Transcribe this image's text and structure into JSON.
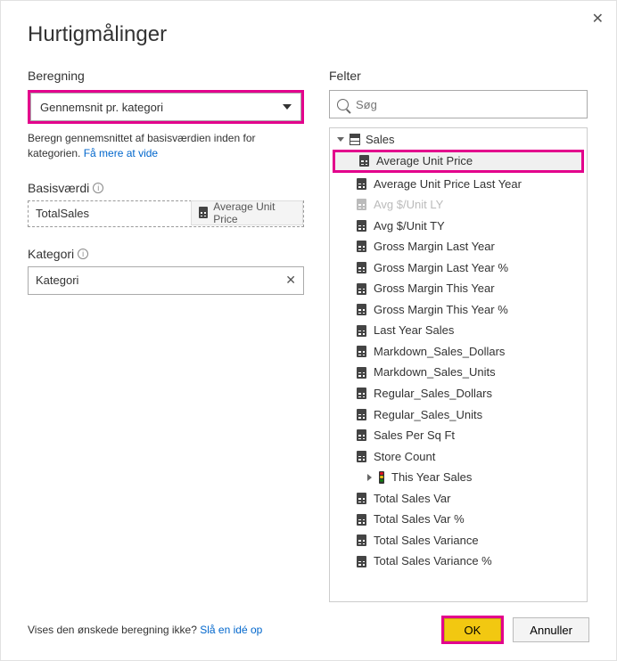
{
  "dialog": {
    "title": "Hurtigmålinger",
    "close": "✕"
  },
  "left": {
    "section_label": "Beregning",
    "select_value": "Gennemsnit pr. kategori",
    "desc_text": "Beregn gennemsnittet af basisværdien inden for kategorien.  ",
    "desc_link": "Få mere at vide",
    "base_label": "Basisværdi",
    "base_value": "TotalSales",
    "drag_ghost": "Average Unit Price",
    "cat_label": "Kategori",
    "cat_value": "Kategori"
  },
  "right": {
    "section_label": "Felter",
    "search_placeholder": "Søg",
    "table_name": "Sales",
    "items": [
      {
        "label": "Average Unit Price",
        "highlighted": true
      },
      {
        "label": "Average Unit Price Last Year"
      },
      {
        "label": "Avg $/Unit LY",
        "disabled": true
      },
      {
        "label": "Avg $/Unit TY"
      },
      {
        "label": "Gross Margin Last Year"
      },
      {
        "label": "Gross Margin Last Year %"
      },
      {
        "label": "Gross Margin This Year"
      },
      {
        "label": "Gross Margin This Year %"
      },
      {
        "label": "Last Year Sales"
      },
      {
        "label": "Markdown_Sales_Dollars"
      },
      {
        "label": "Markdown_Sales_Units"
      },
      {
        "label": "Regular_Sales_Dollars"
      },
      {
        "label": "Regular_Sales_Units"
      },
      {
        "label": "Sales Per Sq Ft"
      },
      {
        "label": "Store Count"
      },
      {
        "label": "This Year Sales",
        "kpi": true
      },
      {
        "label": "Total Sales Var"
      },
      {
        "label": "Total Sales Var %"
      },
      {
        "label": "Total Sales Variance"
      },
      {
        "label": "Total Sales Variance %"
      }
    ]
  },
  "footer": {
    "text": "Vises den ønskede beregning ikke? ",
    "link": "Slå en idé op",
    "ok": "OK",
    "cancel": "Annuller"
  }
}
